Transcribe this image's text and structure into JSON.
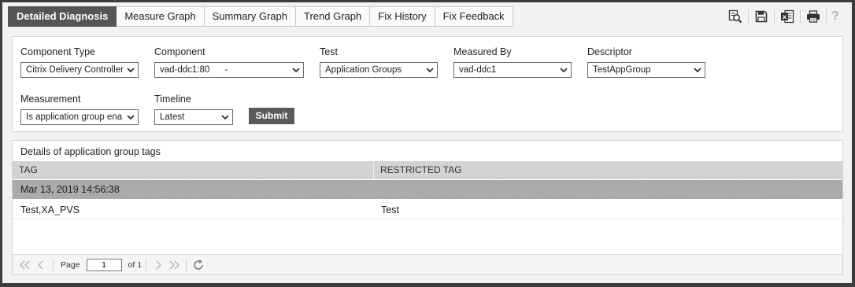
{
  "tabs": [
    {
      "label": "Detailed Diagnosis",
      "active": true
    },
    {
      "label": "Measure Graph",
      "active": false
    },
    {
      "label": "Summary Graph",
      "active": false
    },
    {
      "label": "Trend Graph",
      "active": false
    },
    {
      "label": "Fix History",
      "active": false
    },
    {
      "label": "Fix Feedback",
      "active": false
    }
  ],
  "toolbar": {
    "icons": [
      "zoom-search-icon",
      "save-icon",
      "excel-export-icon",
      "print-icon",
      "help-icon"
    ],
    "help_label": "?"
  },
  "filters": {
    "component_type": {
      "label": "Component Type",
      "value": "Citrix Delivery Controller"
    },
    "component": {
      "label": "Component",
      "value": "vad-ddc1:80      -"
    },
    "test": {
      "label": "Test",
      "value": "Application Groups"
    },
    "measured_by": {
      "label": "Measured By",
      "value": "vad-ddc1"
    },
    "descriptor": {
      "label": "Descriptor",
      "value": "TestAppGroup"
    },
    "measurement": {
      "label": "Measurement",
      "value": "Is application group ena"
    },
    "timeline": {
      "label": "Timeline",
      "value": "Latest"
    },
    "submit_label": "Submit"
  },
  "results": {
    "title": "Details of application group tags",
    "columns": [
      "TAG",
      "RESTRICTED TAG"
    ],
    "group_label": "Mar 13, 2019 14:56:38",
    "rows": [
      [
        "Test,XA_PVS",
        "Test"
      ]
    ]
  },
  "pager": {
    "page_label": "Page",
    "page_value": "1",
    "of_label": "of 1"
  },
  "colors": {
    "active_tab": "#555555",
    "header_bg": "#d3d3d3",
    "group_row_bg": "#a7a7a7",
    "submit_bg": "#5a5a5a"
  }
}
